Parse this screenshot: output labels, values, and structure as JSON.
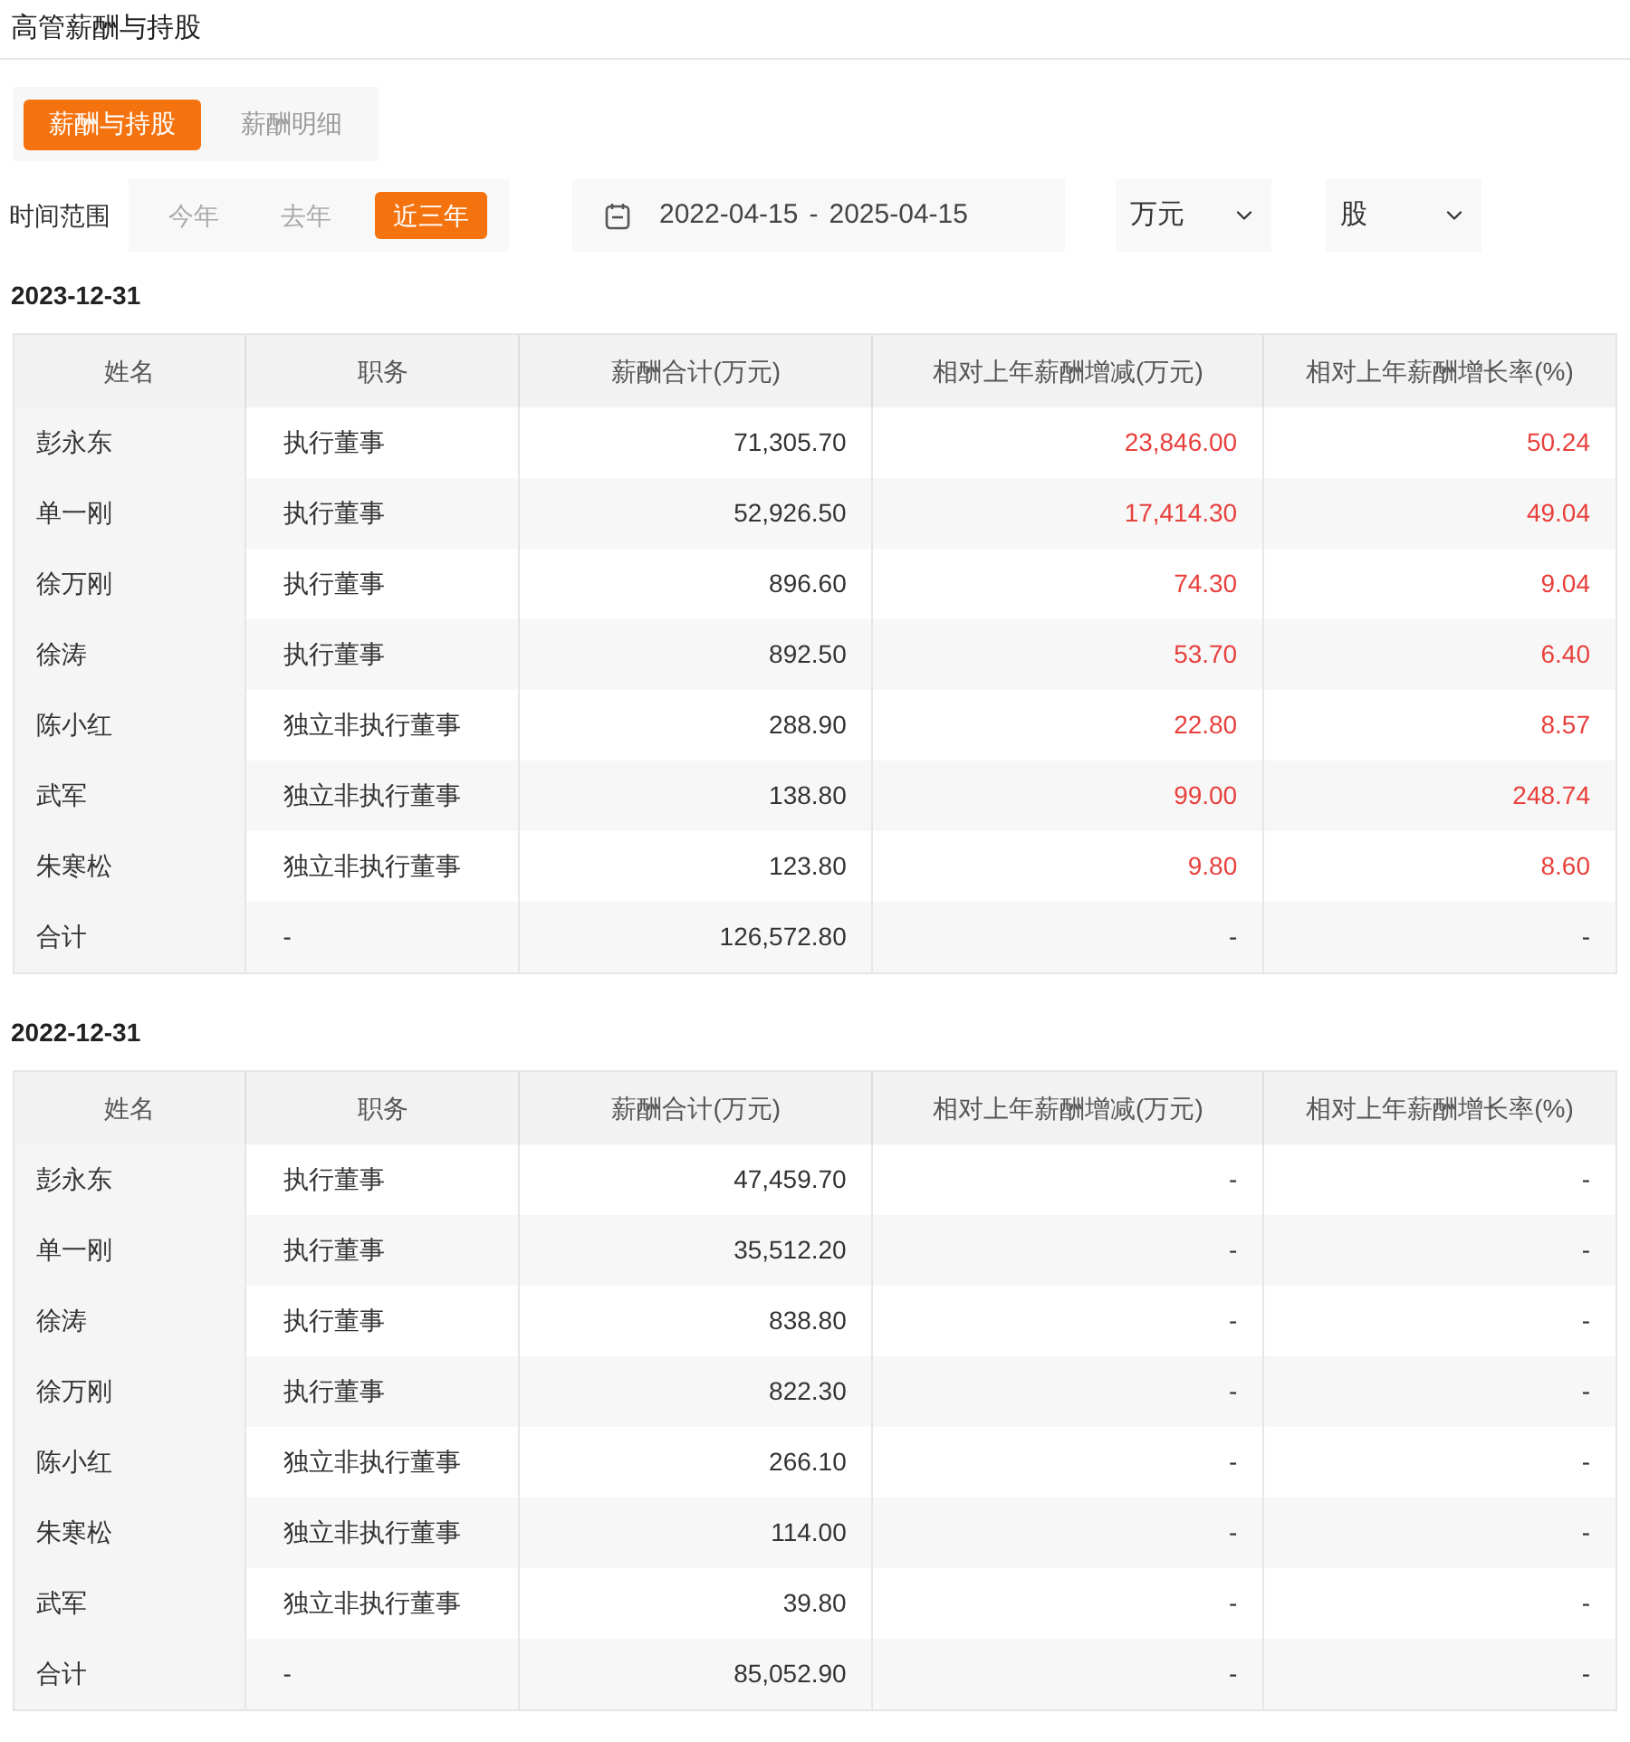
{
  "title": "高管薪酬与持股",
  "tabs": [
    {
      "label": "薪酬与持股",
      "selected": true
    },
    {
      "label": "薪酬明细",
      "selected": false
    }
  ],
  "filters": {
    "range_label": "时间范围",
    "ranges": [
      {
        "label": "今年",
        "selected": false
      },
      {
        "label": "去年",
        "selected": false
      },
      {
        "label": "近三年",
        "selected": true
      }
    ],
    "date_start": "2022-04-15",
    "date_sep": "-",
    "date_end": "2025-04-15",
    "unit_money": "万元",
    "unit_shares": "股"
  },
  "tables": [
    {
      "date": "2023-12-31",
      "columns": [
        "姓名",
        "职务",
        "薪酬合计(万元)",
        "相对上年薪酬增减(万元)",
        "相对上年薪酬增长率(%)"
      ],
      "rows": [
        {
          "cells": [
            "彭永东",
            "执行董事",
            "71,305.70",
            "23,846.00",
            "50.24"
          ],
          "rising": true
        },
        {
          "cells": [
            "单一刚",
            "执行董事",
            "52,926.50",
            "17,414.30",
            "49.04"
          ],
          "rising": true
        },
        {
          "cells": [
            "徐万刚",
            "执行董事",
            "896.60",
            "74.30",
            "9.04"
          ],
          "rising": true
        },
        {
          "cells": [
            "徐涛",
            "执行董事",
            "892.50",
            "53.70",
            "6.40"
          ],
          "rising": true
        },
        {
          "cells": [
            "陈小红",
            "独立非执行董事",
            "288.90",
            "22.80",
            "8.57"
          ],
          "rising": true
        },
        {
          "cells": [
            "武军",
            "独立非执行董事",
            "138.80",
            "99.00",
            "248.74"
          ],
          "rising": true
        },
        {
          "cells": [
            "朱寒松",
            "独立非执行董事",
            "123.80",
            "9.80",
            "8.60"
          ],
          "rising": true
        },
        {
          "cells": [
            "合计",
            "-",
            "126,572.80",
            "-",
            "-"
          ],
          "rising": false
        }
      ]
    },
    {
      "date": "2022-12-31",
      "columns": [
        "姓名",
        "职务",
        "薪酬合计(万元)",
        "相对上年薪酬增减(万元)",
        "相对上年薪酬增长率(%)"
      ],
      "rows": [
        {
          "cells": [
            "彭永东",
            "执行董事",
            "47,459.70",
            "-",
            "-"
          ],
          "rising": false
        },
        {
          "cells": [
            "单一刚",
            "执行董事",
            "35,512.20",
            "-",
            "-"
          ],
          "rising": false
        },
        {
          "cells": [
            "徐涛",
            "执行董事",
            "838.80",
            "-",
            "-"
          ],
          "rising": false
        },
        {
          "cells": [
            "徐万刚",
            "执行董事",
            "822.30",
            "-",
            "-"
          ],
          "rising": false
        },
        {
          "cells": [
            "陈小红",
            "独立非执行董事",
            "266.10",
            "-",
            "-"
          ],
          "rising": false
        },
        {
          "cells": [
            "朱寒松",
            "独立非执行董事",
            "114.00",
            "-",
            "-"
          ],
          "rising": false
        },
        {
          "cells": [
            "武军",
            "独立非执行董事",
            "39.80",
            "-",
            "-"
          ],
          "rising": false
        },
        {
          "cells": [
            "合计",
            "-",
            "85,052.90",
            "-",
            "-"
          ],
          "rising": false
        }
      ]
    }
  ]
}
